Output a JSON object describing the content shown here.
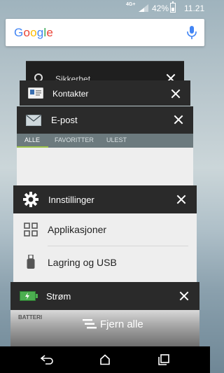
{
  "status_bar": {
    "network": "4G+",
    "battery_percent": "42%",
    "time": "11.21"
  },
  "search": {
    "logo": "Google",
    "mic_icon": "mic-icon"
  },
  "cards": {
    "sikkerhet": {
      "title": "Sikkerhet"
    },
    "kontakter": {
      "title": "Kontakter"
    },
    "epost": {
      "title": "E-post",
      "tabs": [
        "ALLE",
        "FAVORITTER",
        "ULEST"
      ],
      "active_tab": "ALLE"
    },
    "innstillinger": {
      "title": "Innstillinger",
      "items": [
        {
          "label": "Applikasjoner",
          "icon": "grid-icon"
        },
        {
          "label": "Lagring og USB",
          "icon": "usb-icon"
        }
      ]
    },
    "strom": {
      "title": "Strøm",
      "subheading": "BATTERI"
    }
  },
  "clear_all": {
    "label": "Fjern alle"
  },
  "colors": {
    "card_header": "#2b2b2b",
    "tab_accent": "#9ac14a",
    "battery_green": "#4caf50"
  }
}
